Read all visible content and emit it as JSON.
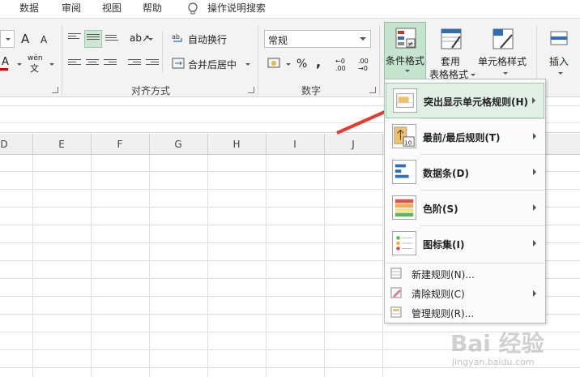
{
  "tabs": [
    "数据",
    "审阅",
    "视图",
    "帮助"
  ],
  "tell_me": "操作说明搜索",
  "ribbon": {
    "font_sizer_up": "A",
    "font_sizer_down": "A",
    "wen": "wén",
    "wen_char": "文",
    "wrap_text": "自动换行",
    "merge_center": "合并后居中",
    "align_group": "对齐方式",
    "number_format_value": "常规",
    "number_group": "数字",
    "percent": "%",
    "comma": ",",
    "inc_decimal": "←0 .00",
    "dec_decimal": ".00 →0",
    "cond_format": "条件格式",
    "table_format_line1": "套用",
    "table_format_line2": "表格格式",
    "cell_styles": "单元格样式",
    "insert": "插入"
  },
  "columns": [
    "D",
    "E",
    "F",
    "G",
    "H",
    "I",
    "J"
  ],
  "menu": {
    "items": [
      {
        "label": "突出显示单元格规则(H)",
        "icon": "highlight-cells-rules-icon"
      },
      {
        "label": "最前/最后规则(T)",
        "icon": "top-bottom-rules-icon"
      },
      {
        "label": "数据条(D)",
        "icon": "data-bars-icon"
      },
      {
        "label": "色阶(S)",
        "icon": "color-scales-icon"
      },
      {
        "label": "图标集(I)",
        "icon": "icon-sets-icon"
      }
    ],
    "small_items": [
      {
        "label": "新建规则(N)...",
        "icon": "new-rule-icon"
      },
      {
        "label": "清除规则(C)",
        "icon": "clear-rules-icon"
      },
      {
        "label": "管理规则(R)...",
        "icon": "manage-rules-icon"
      }
    ]
  },
  "top_bottom_badge": "10",
  "watermark": "Bai 经验",
  "watermark_url": "jingyan.baidu.com",
  "colors": {
    "accent_green": "#c6e3cf",
    "arrow_red": "#e03c31",
    "ribbon_bg": "#f3f3f3"
  }
}
